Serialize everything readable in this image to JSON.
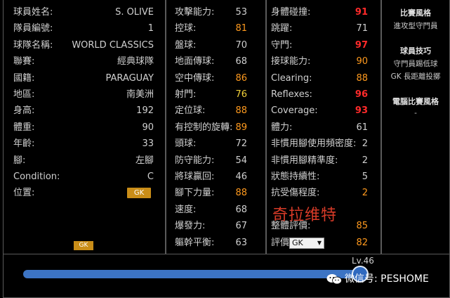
{
  "profile": {
    "rows": [
      {
        "label": "球員姓名:",
        "value": "S. OLIVE"
      },
      {
        "label": "隊員編號:",
        "value": "1"
      },
      {
        "label": "球隊名稱:",
        "value": "WORLD CLASSICS"
      },
      {
        "label": "聯賽:",
        "value": "經典球隊"
      },
      {
        "label": "國籍:",
        "value": "PARAGUAY"
      },
      {
        "label": "地區:",
        "value": "南美洲"
      },
      {
        "label": "身高:",
        "value": "192"
      },
      {
        "label": "體重:",
        "value": "90"
      },
      {
        "label": "年齡:",
        "value": "33"
      },
      {
        "label": "腳:",
        "value": "左腳"
      },
      {
        "label": "Condition:",
        "value": "C"
      },
      {
        "label": "位置:",
        "value": "GK"
      }
    ],
    "faded_text": "",
    "small_badge": "GK"
  },
  "attributes_1": [
    {
      "label": "攻擊能力:",
      "value": "53",
      "color": "gray"
    },
    {
      "label": "控球:",
      "value": "81",
      "color": "orange"
    },
    {
      "label": "盤球:",
      "value": "70",
      "color": "gray"
    },
    {
      "label": "地面傳球:",
      "value": "68",
      "color": "gray"
    },
    {
      "label": "空中傳球:",
      "value": "86",
      "color": "orange"
    },
    {
      "label": "射門:",
      "value": "76",
      "color": "yellow"
    },
    {
      "label": "定位球:",
      "value": "88",
      "color": "orange"
    },
    {
      "label": "有控制的旋轉:",
      "value": "89",
      "color": "orange"
    },
    {
      "label": "頭球:",
      "value": "72",
      "color": "gray"
    },
    {
      "label": "防守能力:",
      "value": "54",
      "color": "gray"
    },
    {
      "label": "將球贏回:",
      "value": "46",
      "color": "gray"
    },
    {
      "label": "腳下力量:",
      "value": "88",
      "color": "orange"
    },
    {
      "label": "速度:",
      "value": "68",
      "color": "gray"
    },
    {
      "label": "爆發力:",
      "value": "67",
      "color": "gray"
    },
    {
      "label": "軀幹平衡:",
      "value": "63",
      "color": "gray"
    }
  ],
  "attributes_2": [
    {
      "label": "身體碰撞:",
      "value": "91",
      "color": "red"
    },
    {
      "label": "跳躍:",
      "value": "71",
      "color": "gray"
    },
    {
      "label": "守門:",
      "value": "97",
      "color": "red"
    },
    {
      "label": "接球能力:",
      "value": "90",
      "color": "orange"
    },
    {
      "label": "Clearing:",
      "value": "88",
      "color": "orange"
    },
    {
      "label": "Reflexes:",
      "value": "96",
      "color": "red"
    },
    {
      "label": "Coverage:",
      "value": "93",
      "color": "red"
    },
    {
      "label": "體力:",
      "value": "61",
      "color": "gray"
    },
    {
      "label": "非慣用腳使用頻密度:",
      "value": "2",
      "color": "gray"
    },
    {
      "label": "非慣用腳精準度:",
      "value": "2",
      "color": "gray"
    },
    {
      "label": "狀態持續性:",
      "value": "5",
      "color": "gray"
    },
    {
      "label": "抗受傷程度:",
      "value": "2",
      "color": "orange"
    }
  ],
  "overlay_name": "奇拉维特",
  "overall": {
    "label": "整體評價:",
    "value": "85",
    "color": "orange"
  },
  "rating": {
    "label": "評價",
    "selected": "GK",
    "value": "82",
    "color": "orange"
  },
  "side": {
    "play_style_title": "比賽風格",
    "play_style": "進攻型守門員",
    "skills_title": "球員技巧",
    "skills": [
      "守門員踢低球",
      "GK 長距離投擲"
    ],
    "ai_style_title": "電腦比賽風格",
    "ai_style": "-"
  },
  "level": {
    "label": "Lv.46",
    "slider_fraction": 0.98
  },
  "watermark": {
    "text": "微信号: PESHOME"
  }
}
